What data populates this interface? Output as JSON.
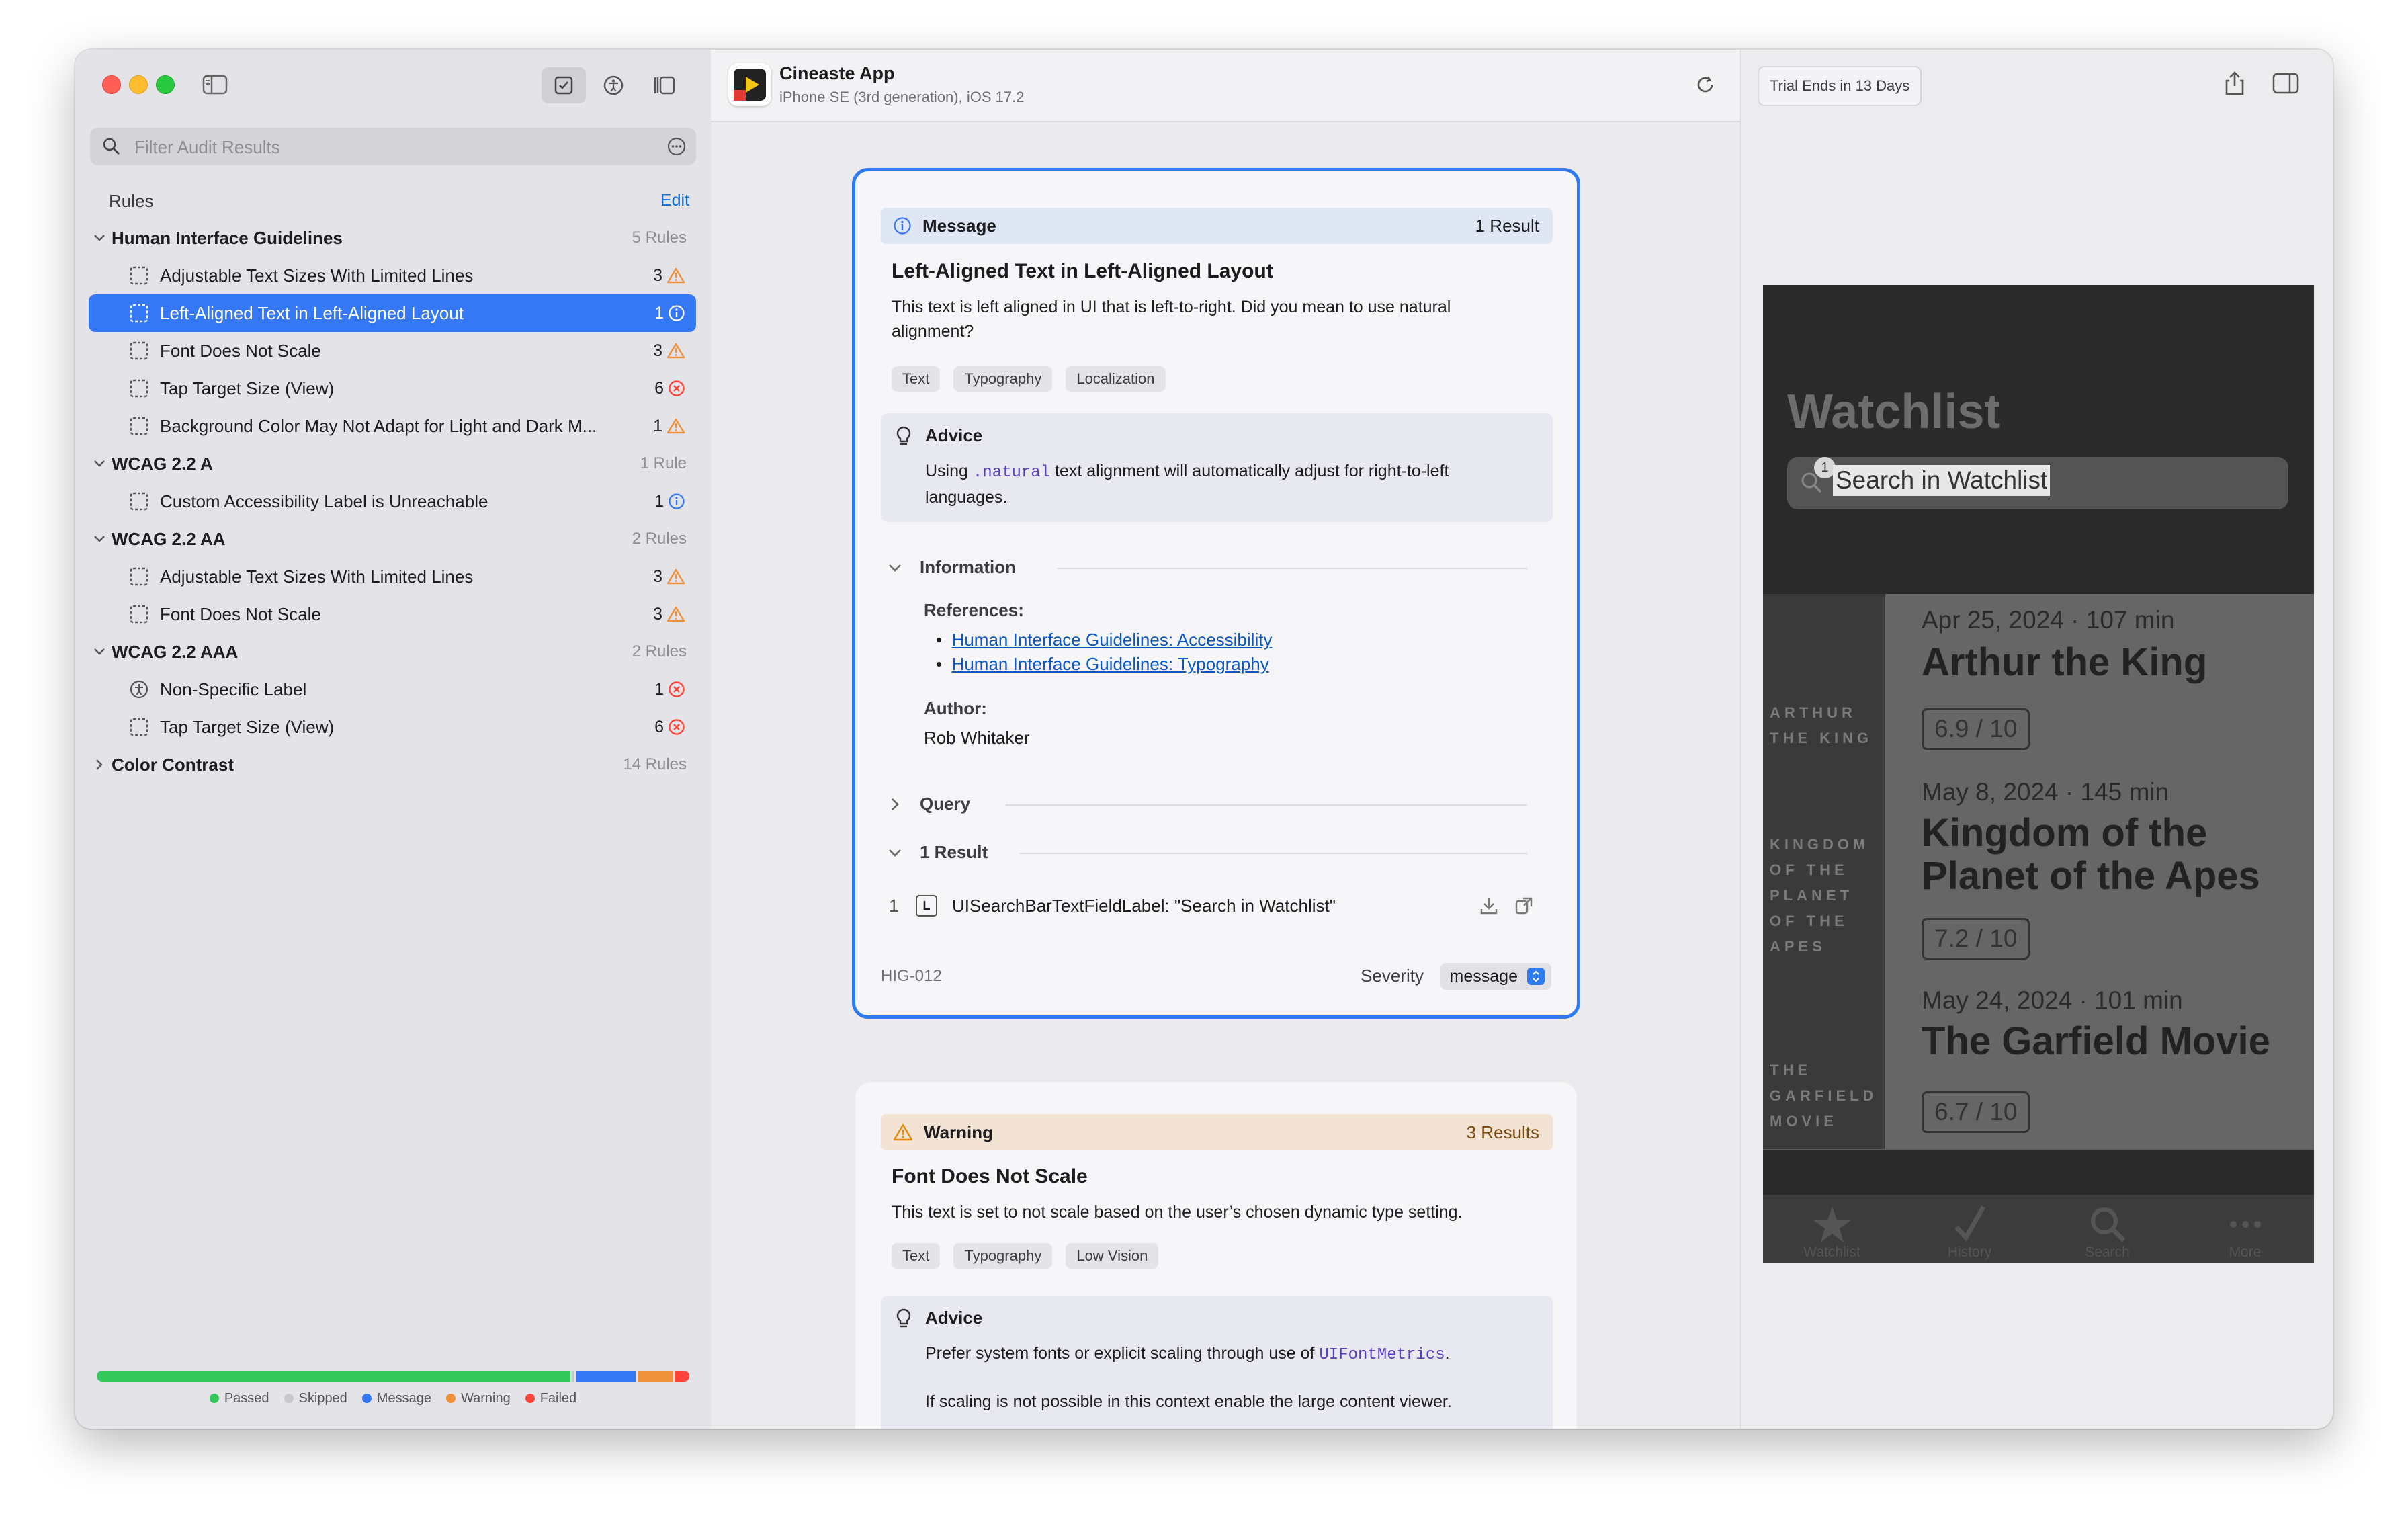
{
  "sidebar": {
    "filter_placeholder": "Filter Audit Results",
    "section_label": "Rules",
    "edit_label": "Edit",
    "groups": [
      {
        "name": "Human Interface Guidelines",
        "count": "5 Rules",
        "items": [
          {
            "label": "Adjustable Text Sizes With Limited Lines",
            "count": "3",
            "severity": "warning"
          },
          {
            "label": "Left-Aligned Text in Left-Aligned Layout",
            "count": "1",
            "severity": "message",
            "selected": true
          },
          {
            "label": "Font Does Not Scale",
            "count": "3",
            "severity": "warning"
          },
          {
            "label": "Tap Target Size (View)",
            "count": "6",
            "severity": "failed"
          },
          {
            "label": "Background Color May Not Adapt for Light and Dark M...",
            "count": "1",
            "severity": "warning"
          }
        ]
      },
      {
        "name": "WCAG 2.2 A",
        "count": "1 Rule",
        "items": [
          {
            "label": "Custom Accessibility Label is Unreachable",
            "count": "1",
            "severity": "message"
          }
        ]
      },
      {
        "name": "WCAG 2.2 AA",
        "count": "2 Rules",
        "items": [
          {
            "label": "Adjustable Text Sizes With Limited Lines",
            "count": "3",
            "severity": "warning"
          },
          {
            "label": "Font Does Not Scale",
            "count": "3",
            "severity": "warning"
          }
        ]
      },
      {
        "name": "WCAG 2.2 AAA",
        "count": "2 Rules",
        "items": [
          {
            "label": "Non-Specific Label",
            "count": "1",
            "severity": "failed",
            "icon": "accessibility"
          },
          {
            "label": "Tap Target Size (View)",
            "count": "6",
            "severity": "failed"
          }
        ]
      },
      {
        "name": "Color Contrast",
        "count": "14 Rules",
        "collapsed": true,
        "items": []
      }
    ],
    "status_bar": [
      {
        "name": "Passed",
        "color": "#34c759",
        "fraction": 0.805
      },
      {
        "name": "Skipped",
        "color": "#c7c7cc",
        "fraction": 0.003
      },
      {
        "name": "Message",
        "color": "#3478f6",
        "fraction": 0.1
      },
      {
        "name": "Warning",
        "color": "#f0913b",
        "fraction": 0.06
      },
      {
        "name": "Failed",
        "color": "#ff453a",
        "fraction": 0.025
      }
    ],
    "legend": [
      "Passed",
      "Skipped",
      "Message",
      "Warning",
      "Failed"
    ]
  },
  "app": {
    "name": "Cineaste App",
    "device": "iPhone SE (3rd generation), iOS 17.2"
  },
  "card1": {
    "type_label": "Message",
    "result_count": "1 Result",
    "title": "Left-Aligned Text in Left-Aligned Layout",
    "description": "This text is left aligned in UI that is left-to-right. Did you mean to use natural alignment?",
    "tags": [
      "Text",
      "Typography",
      "Localization"
    ],
    "advice_label": "Advice",
    "advice_pre": "Using ",
    "advice_code": ".natural",
    "advice_post": " text alignment will automatically adjust for right-to-left languages.",
    "information_label": "Information",
    "references_label": "References:",
    "references": [
      "Human Interface Guidelines: Accessibility",
      "Human Interface Guidelines: Typography"
    ],
    "author_label": "Author:",
    "author": "Rob Whitaker",
    "query_label": "Query",
    "results_label": "1 Result",
    "result_index": "1",
    "result_badge": "L",
    "result_text": "UISearchBarTextFieldLabel: \"Search in Watchlist\"",
    "rule_id": "HIG-012",
    "severity_label": "Severity",
    "severity_value": "message"
  },
  "card2": {
    "type_label": "Warning",
    "result_count": "3 Results",
    "title": "Font Does Not Scale",
    "description": "This text is set to not scale based on the user’s chosen dynamic type setting.",
    "tags": [
      "Text",
      "Typography",
      "Low Vision"
    ],
    "advice_label": "Advice",
    "advice_pre": "Prefer system fonts or explicit scaling through use of ",
    "advice_code": "UIFontMetrics",
    "advice_post": ".",
    "advice_second": "If scaling is not possible in this context enable the large content viewer."
  },
  "right": {
    "trial_label": "Trial Ends in 13 Days"
  },
  "phone": {
    "title": "Watchlist",
    "search_text": "Search in Watchlist",
    "badge": "1",
    "movies": [
      {
        "date": "Apr 25, 2024",
        "duration": "107 min",
        "title": "Arthur the King",
        "rating": "6.9 / 10",
        "poster_text": "ARTHUR THE KING"
      },
      {
        "date": "May 8, 2024",
        "duration": "145 min",
        "title": "Kingdom of the Planet of the Apes",
        "rating": "7.2 / 10",
        "poster_text": "KINGDOM OF THE PLANET OF THE APES"
      },
      {
        "date": "May 24, 2024",
        "duration": "101 min",
        "title": "The Garfield Movie",
        "rating": "6.7 / 10",
        "poster_text": "THE GARFIELD MOVIE"
      }
    ],
    "tabs": [
      "Watchlist",
      "History",
      "Search",
      "More"
    ]
  }
}
